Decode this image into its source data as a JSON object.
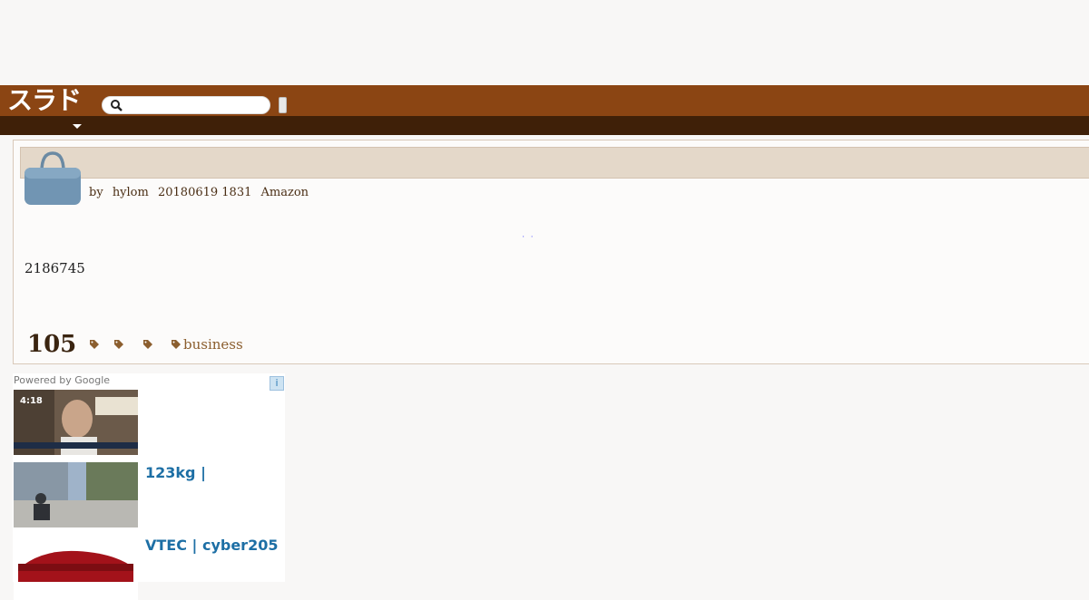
{
  "header": {
    "logo": "スラド",
    "search_placeholder": ""
  },
  "article": {
    "byline": {
      "prefix": "by",
      "author": "hylom",
      "date": "20180619 1831",
      "department": "Amazon"
    },
    "body": "2186745",
    "comment_count": "105",
    "tag_label": "business"
  },
  "ads": {
    "powered_by": "Powered by Google",
    "info": "i",
    "items": [
      {
        "title": "",
        "thumb_caption": "4:18"
      },
      {
        "title": "123kg |"
      },
      {
        "title": "VTEC | cyber205"
      }
    ]
  },
  "colors": {
    "header": "#8b4513",
    "subheader": "#3f2008",
    "title_bar": "#e4d8c9",
    "tag": "#8b5e2e",
    "ad_link": "#1d6fa5"
  }
}
